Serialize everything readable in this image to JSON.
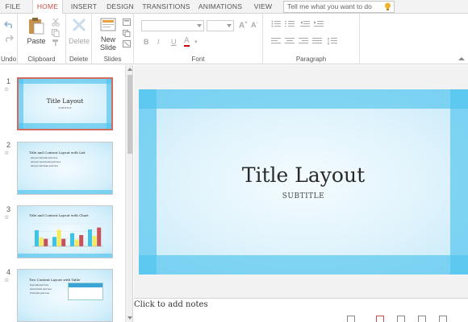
{
  "tabs": [
    {
      "label": "FILE"
    },
    {
      "label": "HOME"
    },
    {
      "label": "INSERT"
    },
    {
      "label": "DESIGN"
    },
    {
      "label": "TRANSITIONS"
    },
    {
      "label": "ANIMATIONS"
    },
    {
      "label": "VIEW"
    }
  ],
  "active_tab": "HOME",
  "tell_me": {
    "placeholder": "Tell me what you want to do"
  },
  "ribbon": {
    "undo_group": {
      "label": "Undo"
    },
    "clipboard": {
      "label": "Clipboard",
      "paste_label": "Paste"
    },
    "delete_group": {
      "label": "Delete",
      "delete_label": "Delete"
    },
    "slides": {
      "label": "Slides",
      "new_slide_label_1": "New",
      "new_slide_label_2": "Slide"
    },
    "font": {
      "label": "Font",
      "bold": "B",
      "italic": "I",
      "underline": "U",
      "color": "A"
    },
    "paragraph": {
      "label": "Paragraph"
    }
  },
  "slides": [
    {
      "number": "1",
      "title": "Title Layout",
      "subtitle": "SUBTITLE"
    },
    {
      "number": "2",
      "title": "Title and Content Layout with List",
      "bullets": [
        "Add your first bullet point here",
        "Add your second bullet point here",
        "Add your third bullet point here"
      ]
    },
    {
      "number": "3",
      "title": "Title and Content Layout with Chart"
    },
    {
      "number": "4",
      "title": "Two Content Layout with Table",
      "bullets": [
        "First bullet point here",
        "Second bullet point here",
        "Third bullet point here"
      ]
    }
  ],
  "main_slide": {
    "title": "Title Layout",
    "subtitle": "SUBTITLE"
  },
  "notes": {
    "placeholder": "Click to add notes"
  },
  "colors": {
    "accent": "#c5504a",
    "band": "#4fc3ee",
    "selected_border": "#d36b5e"
  },
  "chart_data": {
    "type": "bar",
    "categories": [
      "",
      "",
      "",
      ""
    ],
    "series": [
      {
        "values": [
          4.3,
          2.5,
          3.5,
          4.5
        ],
        "color": "#3ec3e8"
      },
      {
        "values": [
          2.4,
          4.4,
          1.8,
          2.8
        ],
        "color": "#f5ea5a"
      },
      {
        "values": [
          2.0,
          2.0,
          3.0,
          5.0
        ],
        "color": "#c8525a"
      }
    ],
    "ylim": [
      0,
      6
    ]
  }
}
